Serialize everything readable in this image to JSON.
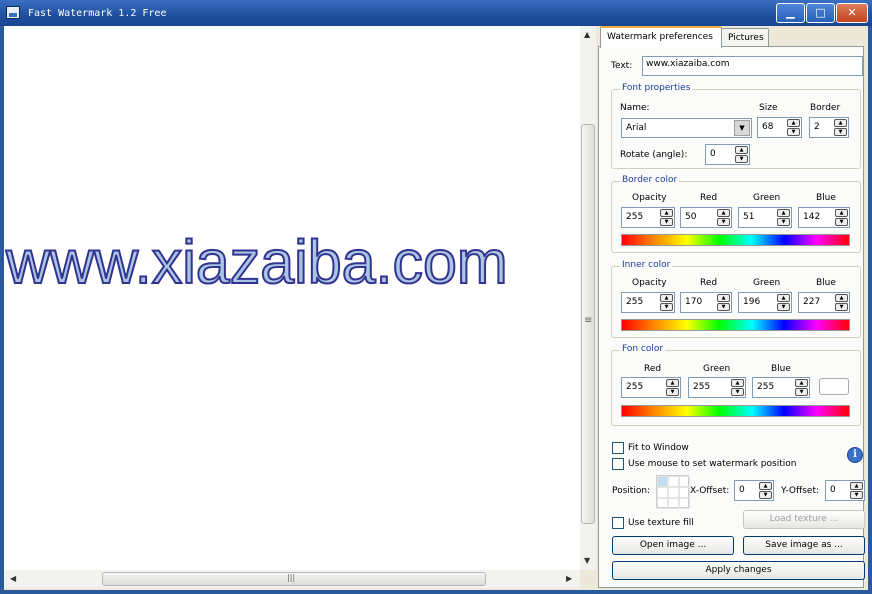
{
  "window": {
    "title": "Fast Watermark 1.2 Free"
  },
  "canvas": {
    "watermark_text": "www.xiazaiba.com"
  },
  "tabs": [
    {
      "label": "Watermark preferences"
    },
    {
      "label": "Pictures"
    }
  ],
  "prefs": {
    "text_label": "Text:",
    "text_value": "www.xiazaiba.com",
    "font": {
      "title": "Font properties",
      "name_label": "Name:",
      "name_value": "Arial",
      "size_label": "Size",
      "size_value": "68",
      "border_label": "Border",
      "border_value": "2",
      "rotate_label": "Rotate (angle):",
      "rotate_value": "0"
    },
    "border_color": {
      "title": "Border color",
      "labels": [
        "Opacity",
        "Red",
        "Green",
        "Blue"
      ],
      "values": [
        "255",
        "50",
        "51",
        "142"
      ]
    },
    "inner_color": {
      "title": "Inner color",
      "labels": [
        "Opacity",
        "Red",
        "Green",
        "Blue"
      ],
      "values": [
        "255",
        "170",
        "196",
        "227"
      ]
    },
    "fon_color": {
      "title": "Fon color",
      "labels": [
        "Red",
        "Green",
        "Blue"
      ],
      "values": [
        "255",
        "255",
        "255"
      ]
    },
    "fit_to_window": "Fit to Window",
    "use_mouse": "Use mouse to set watermark position",
    "position_label": "Position:",
    "x_offset_label": "X-Offset:",
    "x_offset_value": "0",
    "y_offset_label": "Y-Offset:",
    "y_offset_value": "0",
    "use_texture": "Use texture fill",
    "load_texture": "Load texture ...",
    "open_image": "Open image ...",
    "save_image": "Save image as ...",
    "apply_changes": "Apply changes"
  }
}
